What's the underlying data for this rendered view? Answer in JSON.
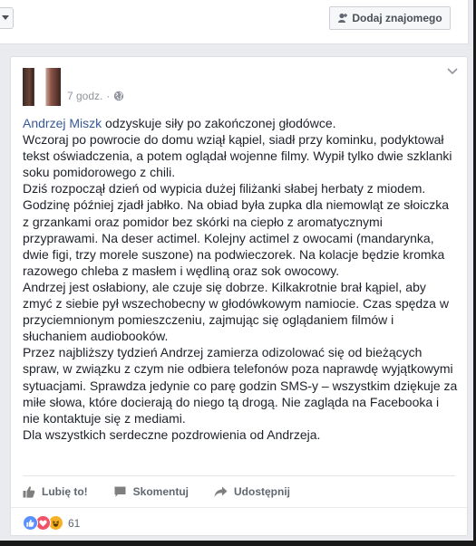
{
  "top_card": {
    "add_friend_label": "Dodaj znajomego",
    "dropdown_icon": "chevron-down-icon"
  },
  "post": {
    "timestamp": "7 godz.",
    "separator": "·",
    "privacy_icon": "globe-icon",
    "author_link": "Andrzej Miszk",
    "paragraphs": [
      " odzyskuje siły po zakończonej głodówce.",
      "Wczoraj po powrocie do domu wziął kąpiel, siadł przy kominku, podyktował tekst oświadczenia, a potem oglądał wojenne filmy. Wypił tylko dwie szklanki soku pomidorowego z chili.",
      "Dziś rozpoczął dzień od wypicia dużej filiżanki słabej herbaty z miodem. Godzinę później zjadł jabłko. Na obiad była zupka dla niemowląt ze słoiczka z grzankami oraz pomidor bez skórki na ciepło z aromatycznymi przyprawami. Na deser actimel. Kolejny actimel z owocami (mandarynka, dwie figi, trzy morele suszone) na podwieczorek. Na kolacje będzie kromka razowego chleba z masłem i wędliną oraz sok owocowy.",
      "Andrzej jest osłabiony, ale czuje się dobrze. Kilkakrotnie brał kąpiel, aby zmyć z siebie pył wszechobecny w głodówkowym namiocie. Czas spędza w przyciemnionym pomieszczeniu, zajmując się oglądaniem filmów i słuchaniem audiobooków.",
      "Przez najbliższy tydzień Andrzej zamierza odizolować się od bieżących spraw, w związku z czym nie odbiera telefonów poza naprawdę wyjątkowymi sytuacjami. Sprawdza jedynie co parę godzin SMS-y – wszystkim dziękuje za miłe słowa, które docierają do niego tą drogą. Nie zagląda na Facebooka i nie kontaktuje się z mediami.",
      "Dla wszystkich serdeczne pozdrowienia od Andrzeja."
    ],
    "actions": {
      "like_label": "Lubię to!",
      "comment_label": "Skomentuj",
      "share_label": "Udostępnij"
    },
    "reactions": {
      "types": [
        "like",
        "love",
        "haha"
      ],
      "count": "61"
    }
  },
  "colors": {
    "link": "#365899",
    "background": "#e9ebee",
    "like_reaction": "#5890ff",
    "love_reaction": "#f25268",
    "haha_reaction": "#f7b125"
  }
}
